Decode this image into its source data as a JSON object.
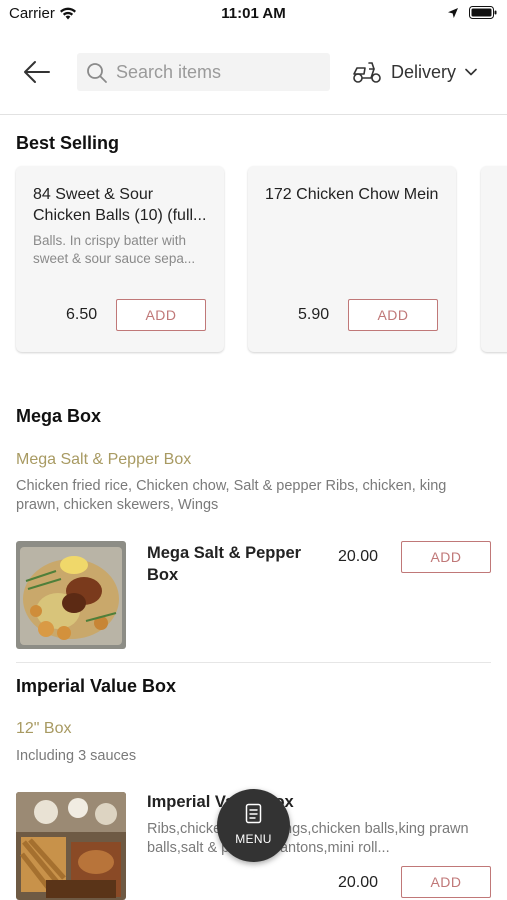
{
  "status_bar": {
    "carrier": "Carrier",
    "time": "11:01 AM"
  },
  "header": {
    "search_placeholder": "Search items",
    "delivery_label": "Delivery"
  },
  "best_selling": {
    "title": "Best Selling",
    "items": [
      {
        "name": "84 Sweet & Sour Chicken Balls (10) (full...",
        "description": "Balls. In crispy batter with sweet & sour sauce sepa...",
        "price": "6.50",
        "add_label": "ADD"
      },
      {
        "name": "172 Chicken Chow Mein",
        "description": "",
        "price": "5.90",
        "add_label": "ADD"
      }
    ]
  },
  "mega_box": {
    "title": "Mega Box",
    "subtitle": "Mega Salt & Pepper Box",
    "description": "Chicken fried rice, Chicken chow, Salt & pepper Ribs, chicken, king prawn, chicken skewers, Wings",
    "item": {
      "name": "Mega Salt & Pepper Box",
      "price": "20.00",
      "add_label": "ADD"
    }
  },
  "imperial_value_box": {
    "title": "Imperial Value Box",
    "subtitle": "12\" Box",
    "description": "Including 3 sauces",
    "item": {
      "name": "Imperial Value Box",
      "description": "Ribs,chicken chow,wings,chicken balls,king prawn balls,salt & pepper,wantons,mini roll...",
      "price": "20.00",
      "add_label": "ADD"
    }
  },
  "menu_button": {
    "label": "MENU"
  },
  "colors": {
    "accent": "#c07878",
    "subtitle": "#a89a62",
    "fab": "#333333"
  }
}
